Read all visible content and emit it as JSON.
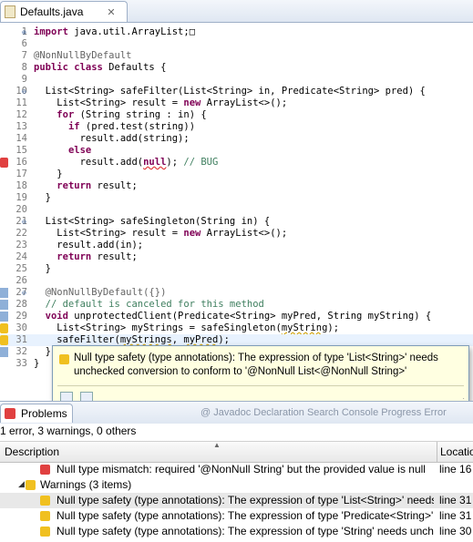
{
  "editor_tab": {
    "title": "Defaults.java",
    "close_glyph": "✕"
  },
  "code_lines": [
    {
      "num": "1",
      "segments": [
        {
          "t": "import",
          "c": "kw"
        },
        {
          "t": " java.util.ArrayList;",
          "c": ""
        },
        {
          "t": "□",
          "c": ""
        }
      ],
      "fold": "+"
    },
    {
      "num": "6",
      "segments": []
    },
    {
      "num": "7",
      "segments": [
        {
          "t": "@NonNullByDefault",
          "c": "ann"
        }
      ]
    },
    {
      "num": "8",
      "segments": [
        {
          "t": "public class",
          "c": "kw"
        },
        {
          "t": " Defaults {",
          "c": ""
        }
      ]
    },
    {
      "num": "9",
      "segments": []
    },
    {
      "num": "10",
      "segments": [
        {
          "t": "  List<String> safeFilter(List<String> in, Predicate<String> pred) {",
          "c": ""
        }
      ],
      "fold": "-"
    },
    {
      "num": "11",
      "segments": [
        {
          "t": "    List<String> result = ",
          "c": ""
        },
        {
          "t": "new",
          "c": "kw"
        },
        {
          "t": " ArrayList<>();",
          "c": ""
        }
      ]
    },
    {
      "num": "12",
      "segments": [
        {
          "t": "    ",
          "c": ""
        },
        {
          "t": "for",
          "c": "kw"
        },
        {
          "t": " (String string : in) {",
          "c": ""
        }
      ]
    },
    {
      "num": "13",
      "segments": [
        {
          "t": "      ",
          "c": ""
        },
        {
          "t": "if",
          "c": "kw"
        },
        {
          "t": " (pred.test(string))",
          "c": ""
        }
      ]
    },
    {
      "num": "14",
      "segments": [
        {
          "t": "        result.add(string);",
          "c": ""
        }
      ]
    },
    {
      "num": "15",
      "segments": [
        {
          "t": "      ",
          "c": ""
        },
        {
          "t": "else",
          "c": "kw"
        }
      ]
    },
    {
      "num": "16",
      "segments": [
        {
          "t": "        result.add(",
          "c": ""
        },
        {
          "t": "null",
          "c": "kw squig"
        },
        {
          "t": "); ",
          "c": ""
        },
        {
          "t": "// BUG",
          "c": "cm"
        }
      ],
      "marker": "err"
    },
    {
      "num": "17",
      "segments": [
        {
          "t": "    }",
          "c": ""
        }
      ]
    },
    {
      "num": "18",
      "segments": [
        {
          "t": "    ",
          "c": ""
        },
        {
          "t": "return",
          "c": "kw"
        },
        {
          "t": " result;",
          "c": ""
        }
      ]
    },
    {
      "num": "19",
      "segments": [
        {
          "t": "  }",
          "c": ""
        }
      ]
    },
    {
      "num": "20",
      "segments": []
    },
    {
      "num": "21",
      "segments": [
        {
          "t": "  List<String> safeSingleton(String in) {",
          "c": ""
        }
      ],
      "fold": "-"
    },
    {
      "num": "22",
      "segments": [
        {
          "t": "    List<String> result = ",
          "c": ""
        },
        {
          "t": "new",
          "c": "kw"
        },
        {
          "t": " ArrayList<>();",
          "c": ""
        }
      ]
    },
    {
      "num": "23",
      "segments": [
        {
          "t": "    result.add(in);",
          "c": ""
        }
      ]
    },
    {
      "num": "24",
      "segments": [
        {
          "t": "    ",
          "c": ""
        },
        {
          "t": "return",
          "c": "kw"
        },
        {
          "t": " result;",
          "c": ""
        }
      ]
    },
    {
      "num": "25",
      "segments": [
        {
          "t": "  }",
          "c": ""
        }
      ]
    },
    {
      "num": "26",
      "segments": []
    },
    {
      "num": "27",
      "segments": [
        {
          "t": "  @NonNullByDefault({})",
          "c": "ann"
        }
      ],
      "fold": "-",
      "marker": "blue"
    },
    {
      "num": "28",
      "segments": [
        {
          "t": "  // default is canceled for this method",
          "c": "cm"
        }
      ],
      "marker": "blue"
    },
    {
      "num": "29",
      "segments": [
        {
          "t": "  ",
          "c": ""
        },
        {
          "t": "void",
          "c": "kw"
        },
        {
          "t": " unprotectedClient(Predicate<String> myPred, String myString) {",
          "c": ""
        }
      ],
      "marker": "blue"
    },
    {
      "num": "30",
      "segments": [
        {
          "t": "    List<String> myStrings = safeSingleton(",
          "c": ""
        },
        {
          "t": "myString",
          "c": "squigw"
        },
        {
          "t": ");",
          "c": ""
        }
      ],
      "marker": "warn"
    },
    {
      "num": "31",
      "segments": [
        {
          "t": "    safeFilter(",
          "c": ""
        },
        {
          "t": "myStrings",
          "c": "squigw"
        },
        {
          "t": ", ",
          "c": ""
        },
        {
          "t": "myPred",
          "c": "squigw"
        },
        {
          "t": ");",
          "c": ""
        }
      ],
      "marker": "warn",
      "highlight": true
    },
    {
      "num": "32",
      "segments": [
        {
          "t": "  }",
          "c": ""
        }
      ],
      "marker": "blue"
    },
    {
      "num": "33",
      "segments": [
        {
          "t": "}",
          "c": ""
        }
      ]
    }
  ],
  "tooltip": {
    "line1": "Null type safety (type annotations): The expression of type 'List<String>' needs",
    "line2": "unchecked conversion to conform to '@NonNull List<@NonNull String>'"
  },
  "problems_view": {
    "tab_label": "Problems",
    "other_tabs": "@ Javadoc   Declaration   Search   Console   Progress   Error",
    "summary": "1 error, 3 warnings, 0 others",
    "columns": {
      "description": "Description",
      "location": "Location"
    },
    "rows": [
      {
        "kind": "err",
        "indent": 1,
        "text": "Null type mismatch: required '@NonNull String' but the provided value is null",
        "loc": "line 16"
      },
      {
        "kind": "group",
        "indent": 0,
        "text": "Warnings (3 items)",
        "loc": ""
      },
      {
        "kind": "warn",
        "indent": 1,
        "text": "Null type safety (type annotations): The expression of type 'List<String>' needs unchecked conversion",
        "loc": "line 31",
        "selected": true
      },
      {
        "kind": "warn",
        "indent": 1,
        "text": "Null type safety (type annotations): The expression of type 'Predicate<String>' needs unchecked",
        "loc": "line 31"
      },
      {
        "kind": "warn",
        "indent": 1,
        "text": "Null type safety (type annotations): The expression of type 'String' needs unchecked conversion",
        "loc": "line 30"
      }
    ]
  }
}
